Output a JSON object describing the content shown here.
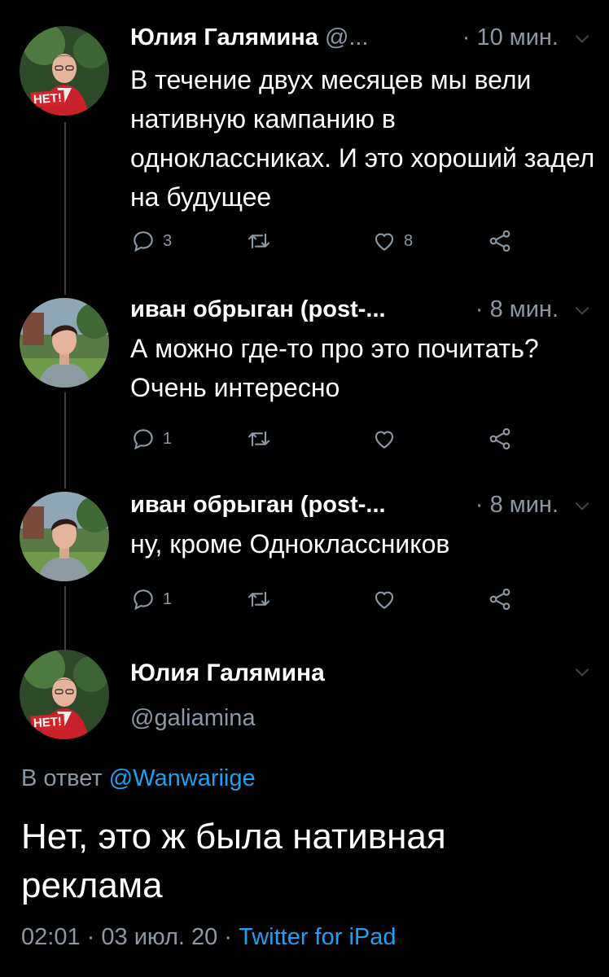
{
  "tweets": [
    {
      "author": "Юлия Галямина",
      "handle": "@...",
      "time": "· 10 мин.",
      "text": "В течение двух месяцев мы вели нативную кампанию в одноклассниках. И это хороший задел на будущее",
      "replies": "3",
      "retweets": "",
      "likes": "8",
      "avatar_badge": "НЕТ!"
    },
    {
      "author": "иван обрыган (post-...",
      "handle": "",
      "time": "· 8 мин.",
      "text": "А можно где-то про это почитать? Очень интересно",
      "replies": "1",
      "retweets": "",
      "likes": ""
    },
    {
      "author": "иван обрыган (post-...",
      "handle": "",
      "time": "· 8 мин.",
      "text": "ну, кроме Одноклассников",
      "replies": "1",
      "retweets": "",
      "likes": ""
    }
  ],
  "main_tweet": {
    "author": "Юлия Галямина",
    "handle": "@galiamina",
    "avatar_badge": "НЕТ!",
    "reply_prefix": "В ответ",
    "reply_to": "@Wanwariige",
    "text": "Нет, это ж была нативная реклама",
    "time": "02:01",
    "date": "03 июл. 20",
    "separator": "·",
    "source": "Twitter for iPad"
  },
  "icons": {
    "reply": "reply-icon",
    "retweet": "retweet-icon",
    "like": "heart-icon",
    "share": "share-icon",
    "more": "chevron-down-icon"
  },
  "colors": {
    "background": "#000000",
    "text": "#ffffff",
    "secondary": "#8b98a5",
    "link": "#1da1f2",
    "badge": "#d3222a"
  }
}
